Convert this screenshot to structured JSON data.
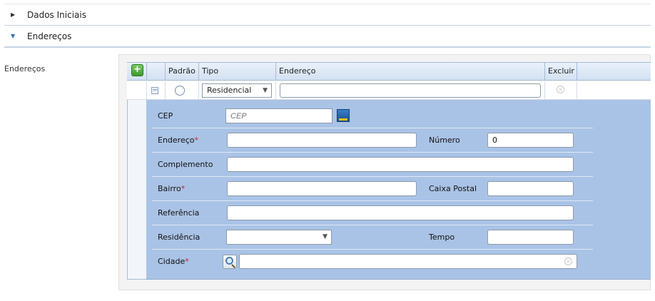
{
  "sections": {
    "dados_iniciais": {
      "label": "Dados Iniciais",
      "arrow": "▶"
    },
    "enderecos": {
      "label": "Endereços",
      "arrow": "▼"
    }
  },
  "left_label": "Endereços",
  "grid": {
    "add_icon": "+",
    "headers": {
      "padrao": "Padrão",
      "tipo": "Tipo",
      "endereco": "Endereço",
      "excluir": "Excluir"
    },
    "row": {
      "expand_icon": "−",
      "tipo_value": "Residencial",
      "caret": "▼",
      "endereco_value": "",
      "delete_icon": "×"
    }
  },
  "form": {
    "cep": {
      "label": "CEP",
      "placeholder": "CEP"
    },
    "endereco": {
      "label": "Endereço",
      "required": "*",
      "value": ""
    },
    "numero": {
      "label": "Número",
      "value": "0"
    },
    "complemento": {
      "label": "Complemento",
      "value": ""
    },
    "bairro": {
      "label": "Bairro",
      "required": "*",
      "value": ""
    },
    "caixa_postal": {
      "label": "Caixa Postal",
      "value": ""
    },
    "referencia": {
      "label": "Referência",
      "value": ""
    },
    "residencia": {
      "label": "Residência",
      "value": "",
      "caret": "▼"
    },
    "tempo": {
      "label": "Tempo",
      "value": ""
    },
    "cidade": {
      "label": "Cidade",
      "required": "*",
      "value": "",
      "clear_icon": "×"
    }
  },
  "icons": {
    "add": "add-icon",
    "expand": "collapse-icon",
    "delete": "delete-icon",
    "cep_search": "correios-search-icon",
    "search": "magnifier-icon"
  }
}
